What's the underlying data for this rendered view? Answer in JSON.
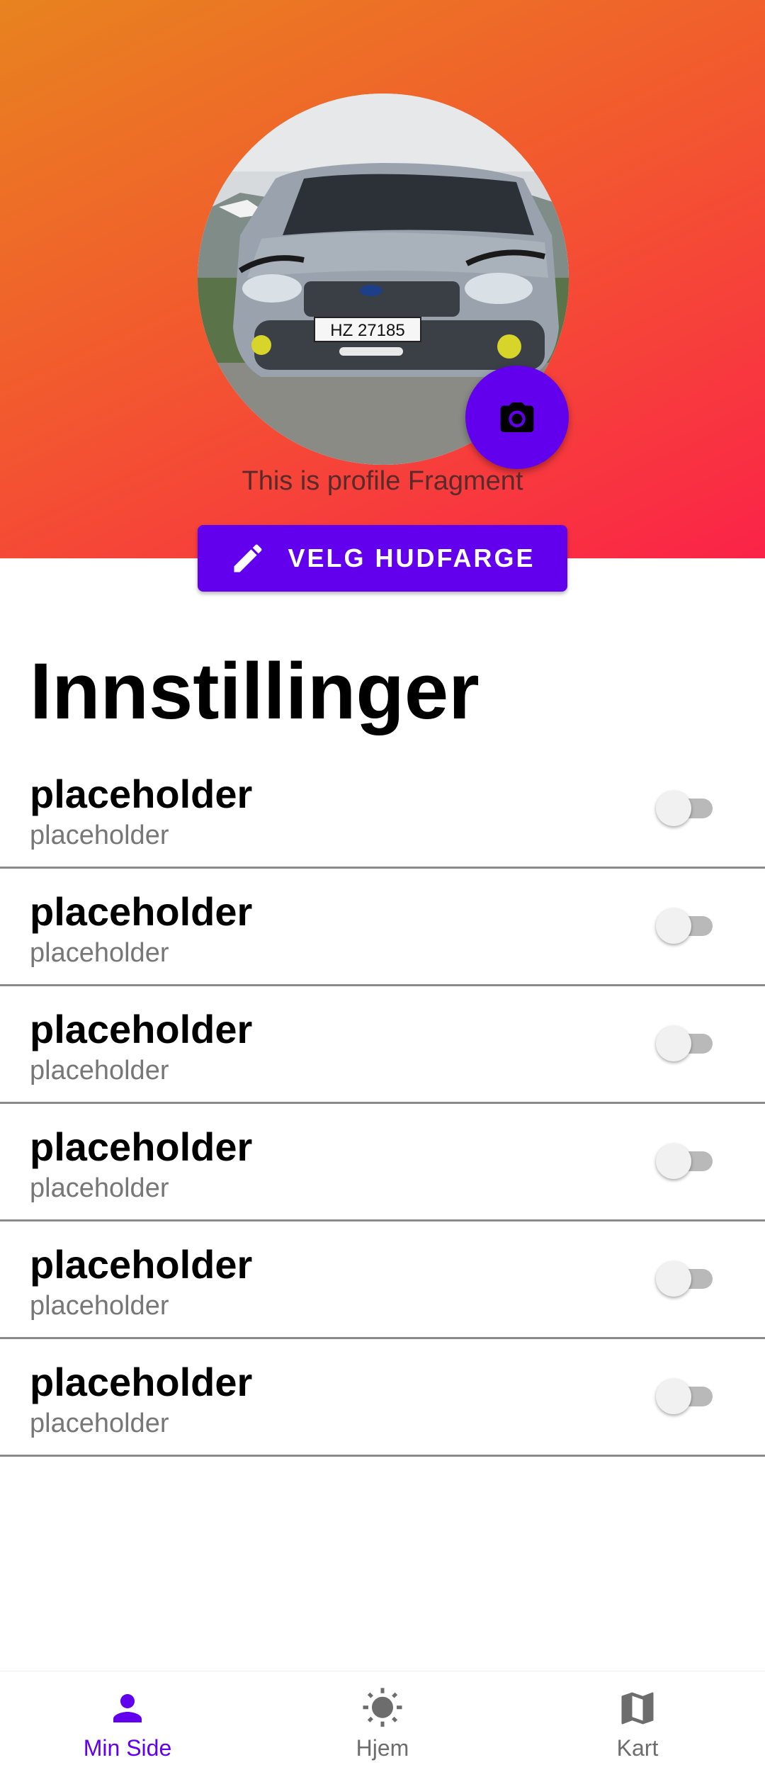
{
  "profile": {
    "caption": "This is profile Fragment",
    "photo_description_icon": "camera-icon",
    "license_plate": "HZ 27185"
  },
  "actions": {
    "pick_skin_color_label": "VELG HUDFARGE"
  },
  "settings": {
    "title": "Innstillinger",
    "items": [
      {
        "title": "placeholder",
        "subtitle": "placeholder",
        "enabled": false
      },
      {
        "title": "placeholder",
        "subtitle": "placeholder",
        "enabled": false
      },
      {
        "title": "placeholder",
        "subtitle": "placeholder",
        "enabled": false
      },
      {
        "title": "placeholder",
        "subtitle": "placeholder",
        "enabled": false
      },
      {
        "title": "placeholder",
        "subtitle": "placeholder",
        "enabled": false
      },
      {
        "title": "placeholder",
        "subtitle": "placeholder",
        "enabled": false
      }
    ]
  },
  "nav": {
    "items": [
      {
        "label": "Min Side",
        "icon": "person-icon",
        "active": true
      },
      {
        "label": "Hjem",
        "icon": "sun-icon",
        "active": false
      },
      {
        "label": "Kart",
        "icon": "map-icon",
        "active": false
      }
    ]
  },
  "colors": {
    "accent": "#6200ee",
    "header_gradient_start": "#e8831f",
    "header_gradient_end": "#fb2348"
  }
}
